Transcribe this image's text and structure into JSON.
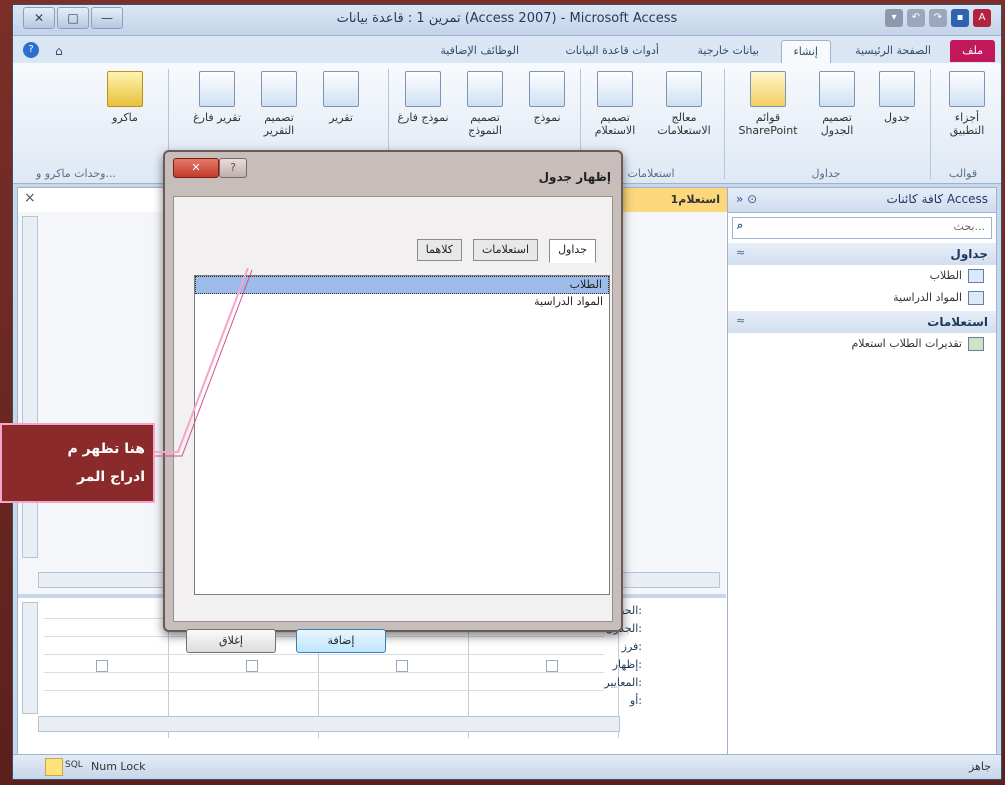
{
  "window": {
    "title": "تمرين 1 : قاعدة بيانات (Access 2007) - Microsoft Access",
    "controls": {
      "close": "✕",
      "maximize": "□",
      "minimize": "—"
    }
  },
  "ribbon_tabs": [
    {
      "label": "ملف"
    },
    {
      "label": "الصفحة الرئيسية"
    },
    {
      "label": "إنشاء"
    },
    {
      "label": "بيانات خارجية"
    },
    {
      "label": "أدوات قاعدة البيانات"
    },
    {
      "label": "الوظائف الإضافية"
    }
  ],
  "ribbon_buttons": [
    {
      "label": "أجزاء التطبيق"
    },
    {
      "label": "جدول"
    },
    {
      "label": "تصميم الجدول"
    },
    {
      "label": "قوائم SharePoint"
    },
    {
      "label": "معالج الاستعلامات"
    },
    {
      "label": "تصميم الاستعلام"
    },
    {
      "label": "نموذج"
    },
    {
      "label": "تصميم النموذج"
    },
    {
      "label": "نموذج فارغ"
    },
    {
      "label": "تقرير"
    },
    {
      "label": "تصميم التقرير"
    },
    {
      "label": "تقرير فارغ"
    },
    {
      "label": "ماكرو"
    }
  ],
  "ribbon_groups": {
    "templates": "قوالب",
    "tables": "جداول",
    "queries": "استعلامات",
    "macros": "وحدات ماكرو و..."
  },
  "document": {
    "tab_title": "استعلام1",
    "close_glyph": "×"
  },
  "query_grid": {
    "labels": [
      "الحقل:",
      "الجدول:",
      "فرز:",
      "إظهار:",
      "المعايير:",
      "أو:"
    ]
  },
  "nav_pane": {
    "title": "كافة كائنات Access",
    "search_placeholder": "بحث...",
    "sections": [
      {
        "title": "جداول",
        "items": [
          "الطلاب",
          "المواد الدراسية"
        ]
      },
      {
        "title": "استعلامات",
        "items": [
          "تقديرات الطلاب استعلام"
        ]
      }
    ]
  },
  "dialog": {
    "title": "إظهار جدول",
    "tabs": [
      "جداول",
      "استعلامات",
      "كلاهما"
    ],
    "list_items": [
      "الطلاب",
      "المواد الدراسية"
    ],
    "selected_index": 0,
    "buttons": {
      "add": "إضافة",
      "close": "إغلاق"
    }
  },
  "annotation": {
    "line1": "هنا تظهر م",
    "line2": "ادراج المر"
  },
  "status_bar": {
    "view_label": "SQL",
    "num_lock": "Num Lock",
    "ready": "جاهز"
  }
}
